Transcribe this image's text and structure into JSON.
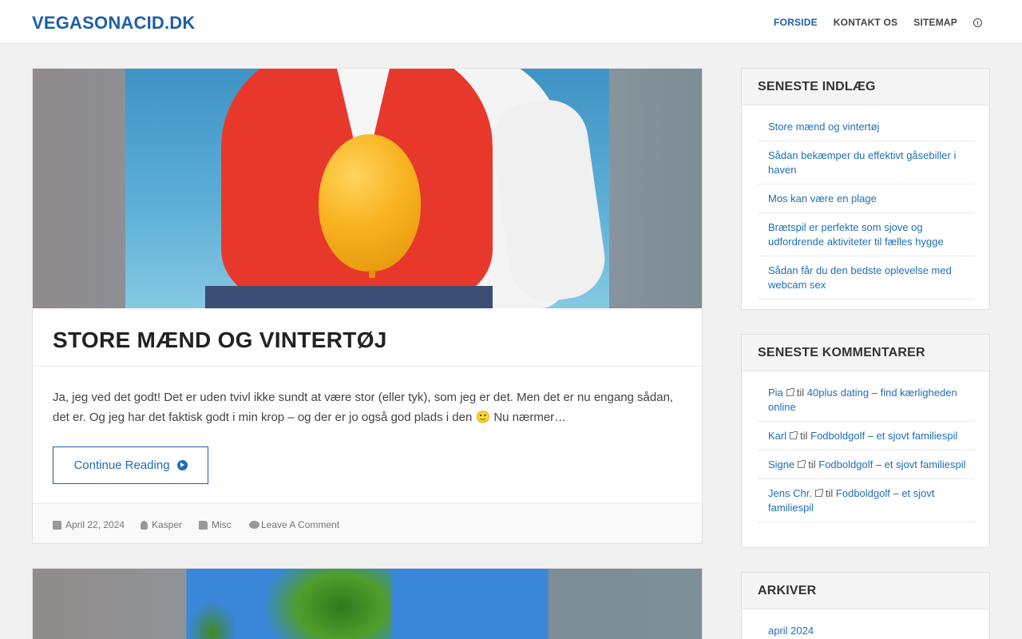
{
  "header": {
    "site_title": "VEGASONACID.DK",
    "nav": [
      "FORSIDE",
      "KONTAKT OS",
      "SITEMAP"
    ]
  },
  "post": {
    "title": "STORE MÆND OG VINTERTØJ",
    "excerpt": "Ja, jeg ved det godt! Det er uden tvivl ikke sundt at være stor (eller tyk), som jeg er det. Men det er nu engang sådan, det er. Og jeg har det faktisk godt i min krop – og der er jo også god plads i den 🙂 Nu nærmer…",
    "continue_label": "Continue Reading",
    "date": "April 22, 2024",
    "author": "Kasper",
    "category": "Misc",
    "comments": "Leave A Comment"
  },
  "widgets": {
    "recent_posts": {
      "title": "SENESTE INDLÆG",
      "items": [
        "Store mænd og vintertøj",
        "Sådan bekæmper du effektivt gåsebiller i haven",
        "Mos kan være en plage",
        "Brætspil er perfekte som sjove og udfordrende aktiviteter til fælles hygge",
        "Sådan får du den bedste oplevelse med webcam sex"
      ]
    },
    "recent_comments": {
      "title": "SENESTE KOMMENTARER",
      "sep": "til",
      "items": [
        {
          "author": "Pia",
          "post": "40plus dating – find kærligheden online"
        },
        {
          "author": "Karl",
          "post": "Fodboldgolf – et sjovt familiespil"
        },
        {
          "author": "Signe",
          "post": "Fodboldgolf – et sjovt familiespil"
        },
        {
          "author": "Jens Chr.",
          "post": "Fodboldgolf – et sjovt familiespil"
        }
      ]
    },
    "archives": {
      "title": "ARKIVER",
      "items": [
        "april 2024"
      ]
    }
  },
  "colors": {
    "brand": "#1e5fa6",
    "link": "#1e6fb6"
  }
}
